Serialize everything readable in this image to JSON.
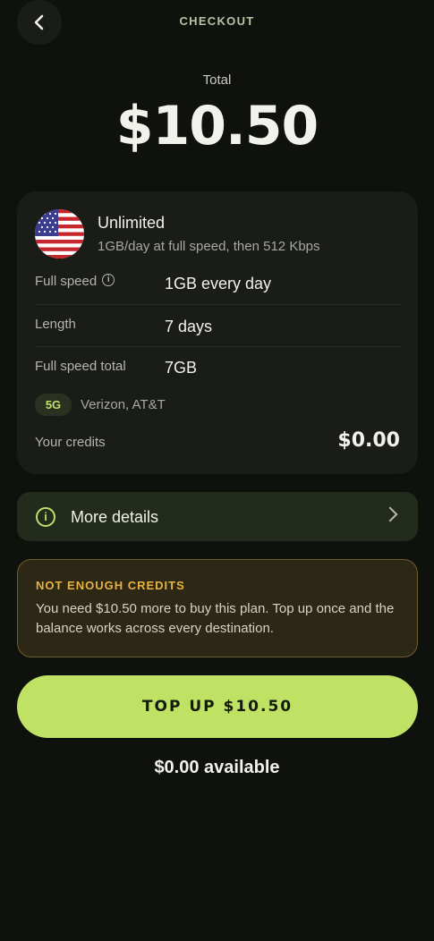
{
  "header": {
    "title": "CHECKOUT",
    "back_icon": "chevron-left-icon"
  },
  "total": {
    "label": "Total",
    "amount": "$10.50"
  },
  "plan": {
    "flag_icon": "us-flag-icon",
    "name": "Unlimited",
    "description": "1GB/day at full speed, then 512 Kbps",
    "rows": [
      {
        "label": "Full speed",
        "value": "1GB every day"
      },
      {
        "label": "Length",
        "value": "7 days"
      },
      {
        "label": "Full speed total",
        "value": "7GB"
      }
    ],
    "network_badge": "5G",
    "carriers": "Verizon, AT&T",
    "credits_label": "Your credits",
    "credits_value": "$0.00"
  },
  "more_details": {
    "label": "More details"
  },
  "warning": {
    "title": "NOT ENOUGH CREDITS",
    "text": "You need $10.50 more to buy this plan. Top up once and the balance works across every destination."
  },
  "topup_button": {
    "label": "TOP UP $10.50"
  },
  "available": "$0.00 available",
  "colors": {
    "background": "#0e110c",
    "accent": "#bfe265",
    "warning": "#e8b23e"
  }
}
